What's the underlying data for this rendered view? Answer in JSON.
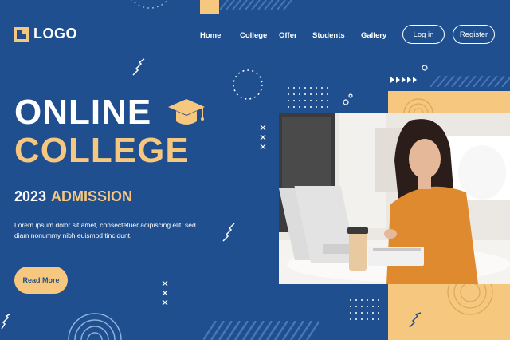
{
  "brand": {
    "logo_text": "LOGO"
  },
  "nav": {
    "items": [
      {
        "label": "Home"
      },
      {
        "label": "College"
      },
      {
        "label": "Offer"
      },
      {
        "label": "Students"
      },
      {
        "label": "Gallery"
      }
    ],
    "login_label": "Log in",
    "register_label": "Register"
  },
  "hero": {
    "title_line1": "ONLINE",
    "title_line2": "COLLEGE",
    "year": "2023",
    "admission": "ADMISSION",
    "description": "Lorem ipsum dolor sit amet, consectetuer adipiscing elit, sed diam nonummy nibh euismod tincidunt.",
    "cta_label": "Read More"
  },
  "colors": {
    "background": "#1f4f8f",
    "accent": "#f6c77e",
    "text": "#ffffff"
  },
  "icons": {
    "logo": "logo-mark-icon",
    "cap": "graduation-cap-icon"
  }
}
